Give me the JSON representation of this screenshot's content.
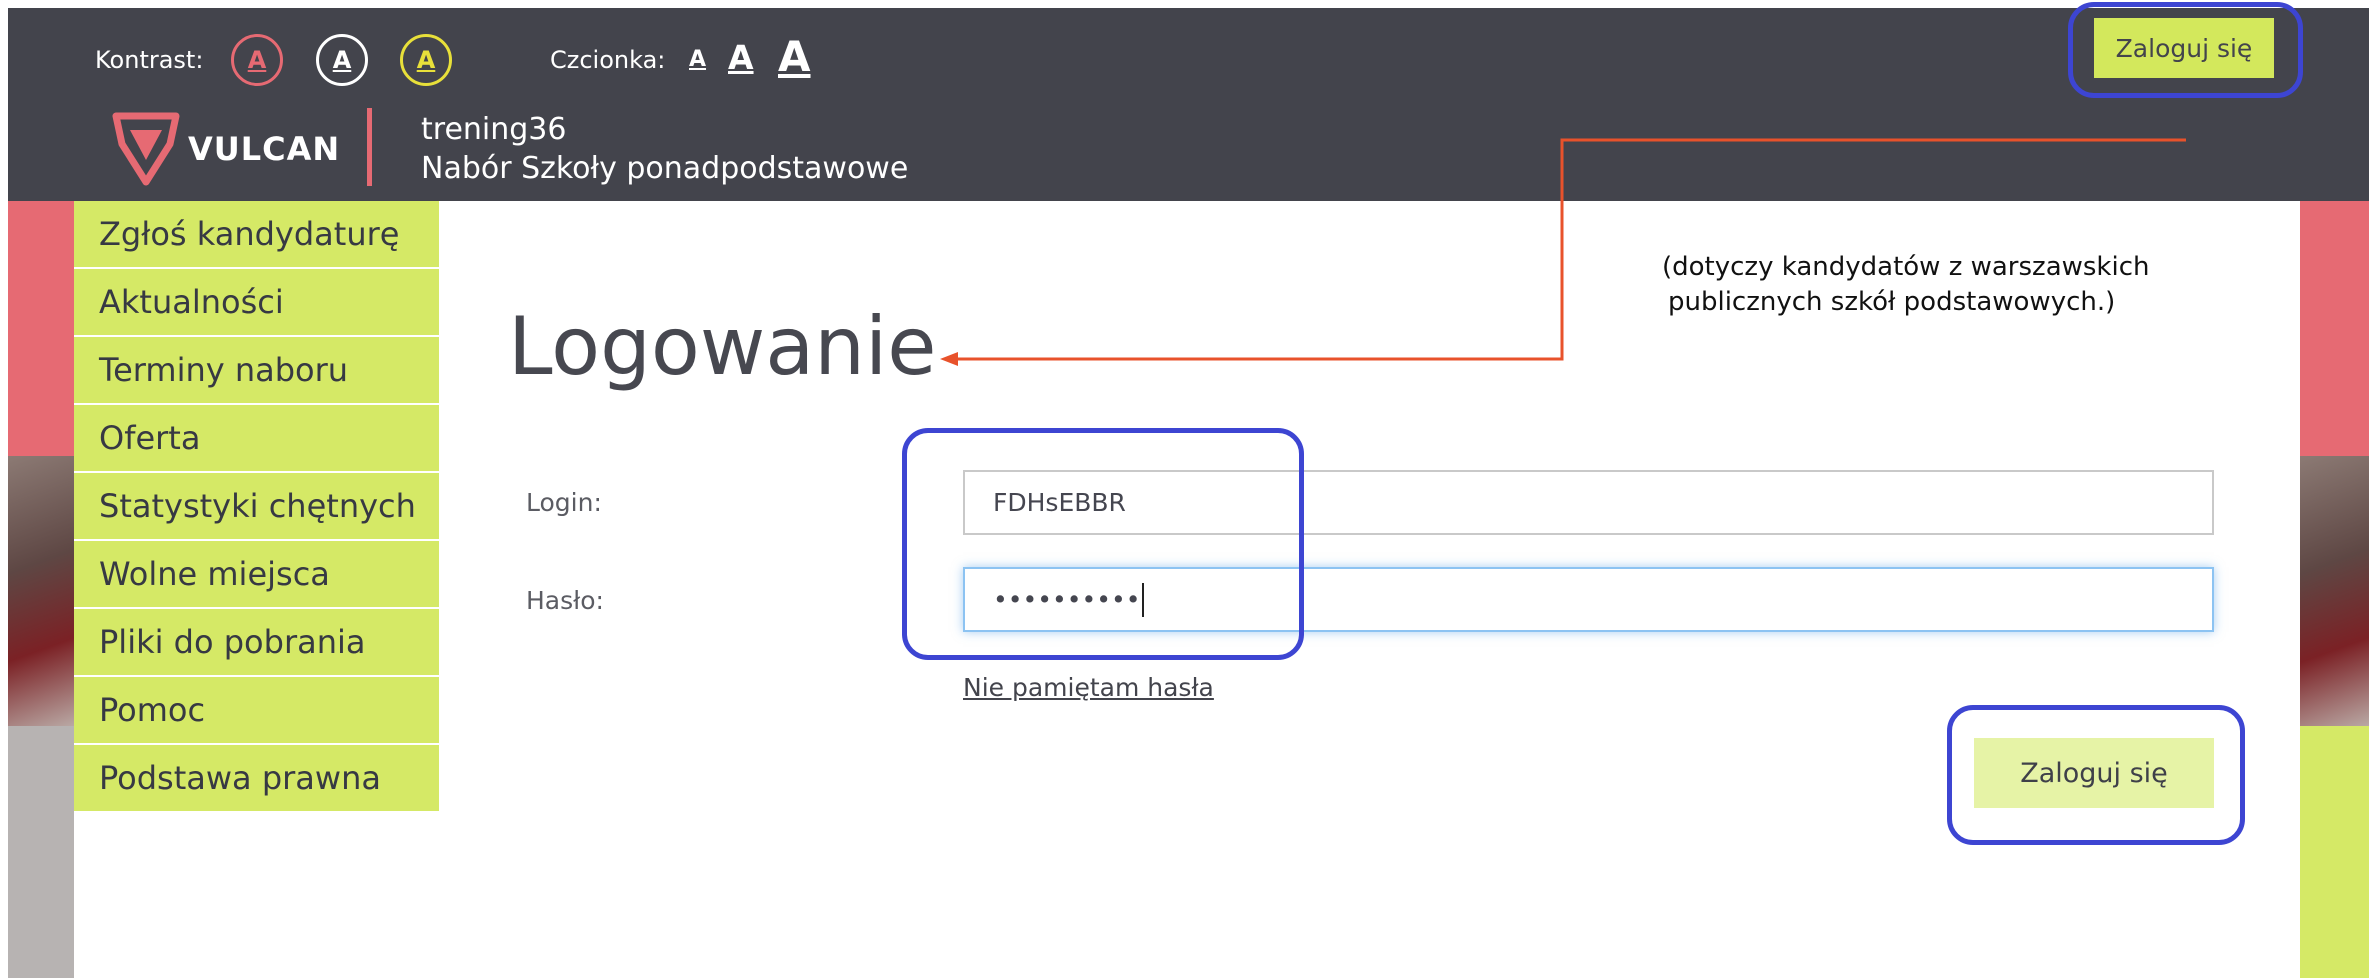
{
  "header": {
    "contrast_label": "Kontrast:",
    "contrast_options": [
      {
        "letter": "A",
        "color": "#e66a73"
      },
      {
        "letter": "A",
        "color": "#ffffff"
      },
      {
        "letter": "A",
        "color": "#e8e03a"
      }
    ],
    "font_label": "Czcionka:",
    "font_sizes": [
      "A",
      "A",
      "A"
    ],
    "logo_text": "VULCAN",
    "site_name": "trening36",
    "site_subtitle": "Nabór Szkoły ponadpodstawowe",
    "login_button": "Zaloguj się"
  },
  "menu": {
    "items": [
      "Zgłoś kandydaturę",
      "Aktualności",
      "Terminy naboru",
      "Oferta",
      "Statystyki chętnych",
      "Wolne miejsca",
      "Pliki do pobrania",
      "Pomoc",
      "Podstawa prawna"
    ]
  },
  "main": {
    "title": "Logowanie",
    "login_label": "Login:",
    "login_value": "FDHsEBBR",
    "password_label": "Hasło:",
    "password_value": "••••••••••",
    "forgot_link": "Nie pamiętam hasła",
    "submit_button": "Zaloguj się"
  },
  "annotation": {
    "note_line1": "(dotyczy kandydatów z warszawskich",
    "note_line2": "publicznych szkół podstawowych.)"
  },
  "colors": {
    "header_bg": "#43444c",
    "accent_lime": "#d5e966",
    "accent_pink": "#e66a73",
    "annotation_blue": "#3d45d2",
    "annotation_arrow": "#e8522b"
  }
}
